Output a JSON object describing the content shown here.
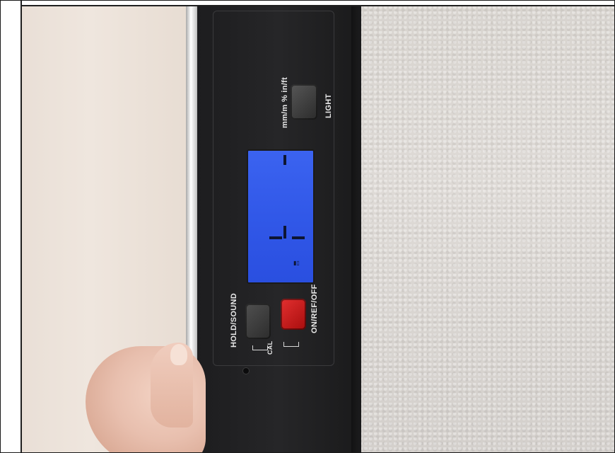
{
  "device": {
    "labels": {
      "mode_button": "mm/m % in/ft",
      "light_button": "LIGHT",
      "hold_button": "HOLD/SOUND",
      "cal_label": "CAL",
      "on_button": "ON/REF/OFF"
    },
    "screen": {
      "backlight_color": "#3158e8",
      "battery_icon": "battery-icon"
    },
    "button_colors": {
      "light": "#3a3a3a",
      "hold": "#3a3a3a",
      "on": "#d42020"
    }
  }
}
